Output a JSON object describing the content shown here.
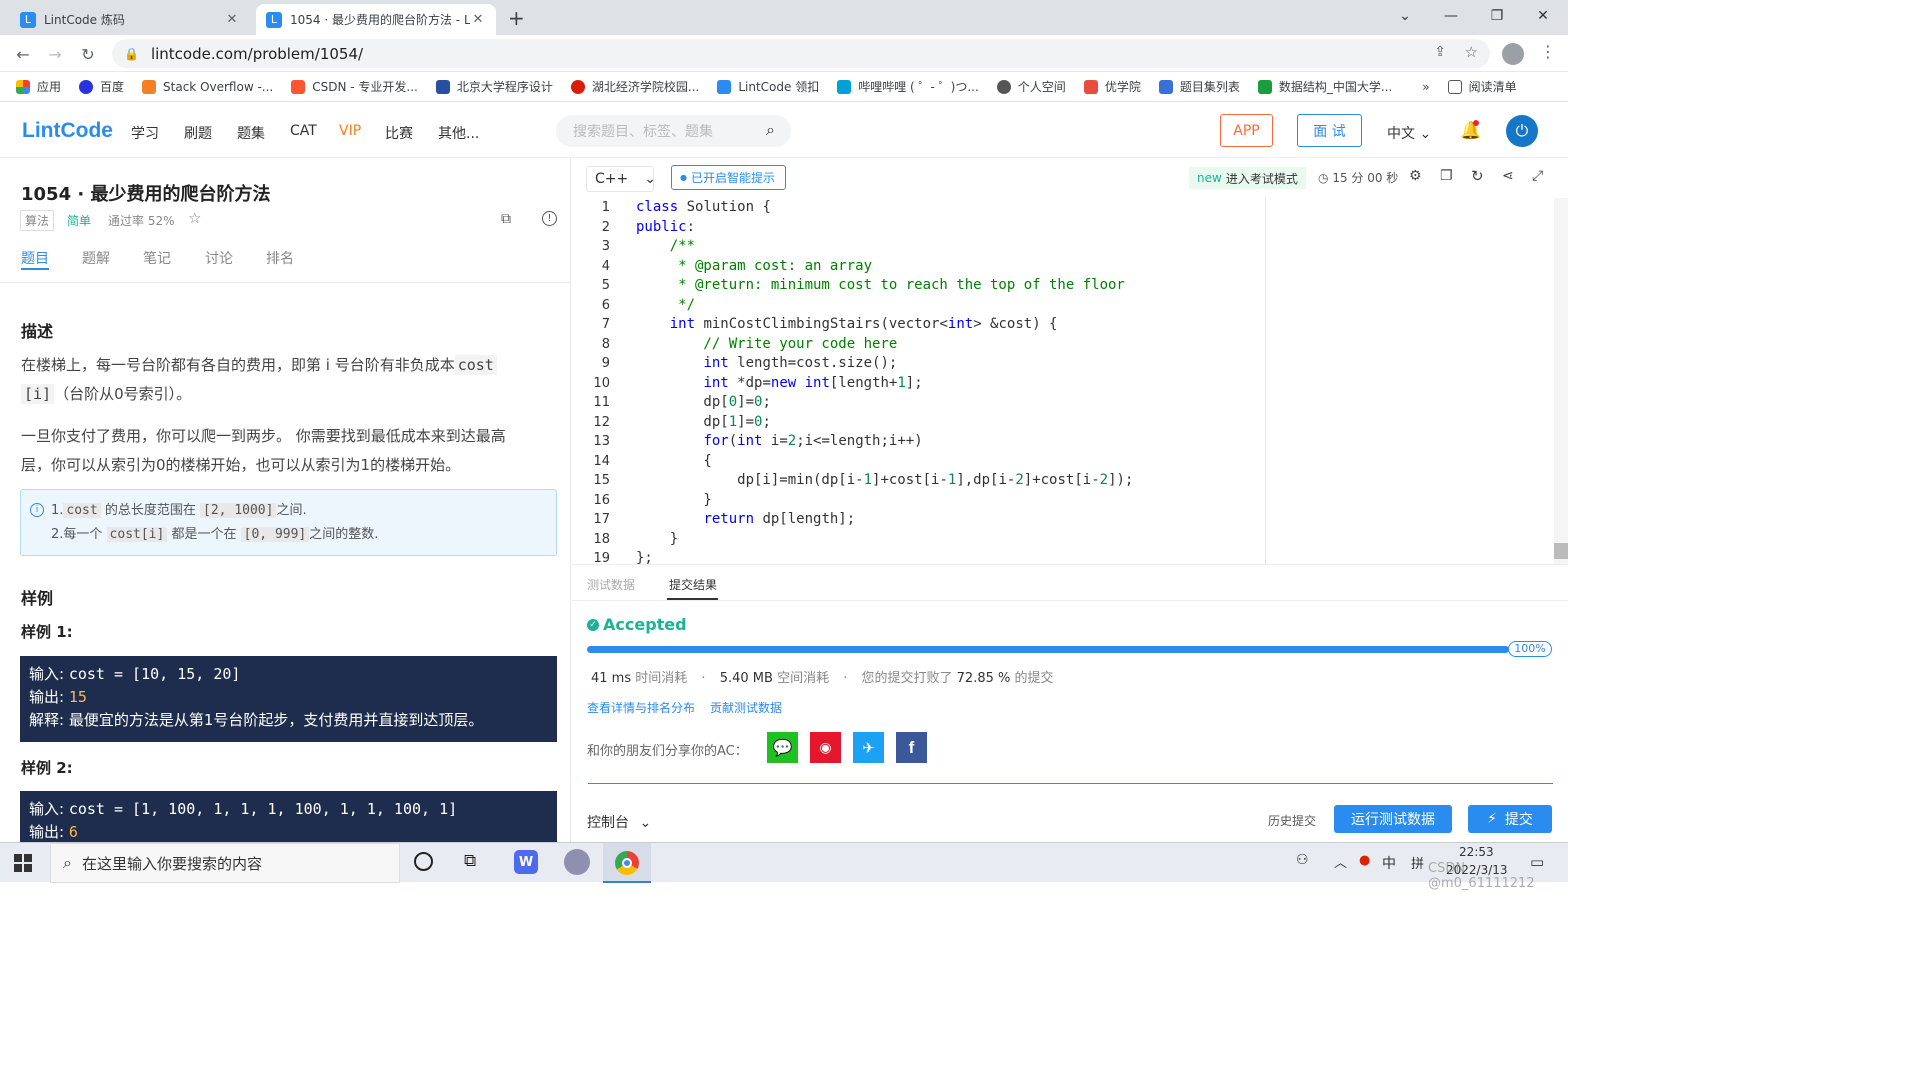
{
  "browser": {
    "tabs": [
      {
        "title": "LintCode 炼码",
        "close": "✕"
      },
      {
        "title": "1054 · 最少费用的爬台阶方法 - L",
        "close": "✕"
      }
    ],
    "new_tab": "+",
    "url": "lintcode.com/problem/1054/",
    "bookmarks": [
      "应用",
      "百度",
      "Stack Overflow -...",
      "CSDN - 专业开发...",
      "北京大学程序设计",
      "湖北经济学院校园...",
      "LintCode 领扣",
      "哔哩哔哩 ( ゜- ゜)つ...",
      "个人空间",
      "优学院",
      "题目集列表",
      "数据结构_中国大学..."
    ],
    "bookmark_more": "»",
    "reading_list": "阅读清单"
  },
  "site": {
    "logo": "LintCode",
    "nav": [
      "学习",
      "刷题",
      "题集",
      "CAT",
      "VIP",
      "比赛",
      "其他..."
    ],
    "search_placeholder": "搜索题目、标签、题集",
    "app_button": "APP",
    "interview_button": "面 试",
    "language": "中文"
  },
  "problem": {
    "title": "1054 · 最少费用的爬台阶方法",
    "tag": "算法",
    "difficulty": "简单",
    "pass_rate": "通过率 52%",
    "tabs": [
      "题目",
      "题解",
      "笔记",
      "讨论",
      "排名"
    ],
    "desc_heading": "描述",
    "desc_p1a": "在楼梯上，每一号台阶都有各自的费用，即第 i 号台阶有非负成本",
    "desc_code1": "cost",
    "desc_code2": "[i]",
    "desc_p1b": "（台阶从0号索引）。",
    "desc_p2a": "一旦你支付了费用，你可以爬一到两步。 你需要找到最低成本来到达最高",
    "desc_p2b": "层，你可以从索引为0的楼梯开始，也可以从索引为1的楼梯开始。",
    "note1_pre": "1.",
    "note1_code": "cost",
    "note1_mid": "的总长度范围在",
    "note1_range": "[2, 1000]",
    "note1_post": "之间.",
    "note2_pre": "2.每一个",
    "note2_code": "cost[i]",
    "note2_mid": "都是一个在",
    "note2_range": "[0, 999]",
    "note2_post": "之间的整数.",
    "examples_heading": "样例",
    "ex1_heading": "样例 1:",
    "ex1_input_label": "输入: ",
    "ex1_input": "cost = [10, 15, 20]",
    "ex1_output_label": "输出: ",
    "ex1_output": "15",
    "ex1_explain_label": "解释: ",
    "ex1_explain": "最便宜的方法是从第1号台阶起步，支付费用并直接到达顶层。",
    "ex2_heading": "样例 2:",
    "ex2_input_label": "输入: ",
    "ex2_input": "cost = [1, 100, 1, 1, 1, 100, 1, 1, 100, 1]",
    "ex2_output_label": "输出: ",
    "ex2_output": "6"
  },
  "editor": {
    "language": "C++",
    "smart_hint": "已开启智能提示",
    "exam_badge": "new",
    "exam_label": "进入考试模式",
    "timer": "15 分 00 秒",
    "line_numbers": [
      "1",
      "2",
      "3",
      "4",
      "5",
      "6",
      "7",
      "8",
      "9",
      "10",
      "11",
      "12",
      "13",
      "14",
      "15",
      "16",
      "17",
      "18",
      "19"
    ]
  },
  "result": {
    "tabs": [
      "测试数据",
      "提交结果"
    ],
    "status": "Accepted",
    "progress_label": "100%",
    "progress_value": 1.0,
    "time_value": "41 ms",
    "time_label": "时间消耗",
    "mem_value": "5.40 MB",
    "mem_label": "空间消耗",
    "beat_pre": "您的提交打败了",
    "beat_value": "72.85 %",
    "beat_post": "的提交",
    "link_details": "查看详情与排名分布",
    "link_contribute": "贡献测试数据",
    "share_label": "和你的朋友们分享你的AC："
  },
  "bottom": {
    "console": "控制台",
    "history": "历史提交",
    "run": "运行测试数据",
    "submit": "提交"
  },
  "taskbar": {
    "search_placeholder": "在这里输入你要搜索的内容",
    "ime1": "中",
    "ime2": "拼",
    "time": "22:53",
    "date": "2022/3/13",
    "watermark": "CSDN @m0_61111212"
  },
  "colors": {
    "brand": "#2b8cf0",
    "accepted": "#1ab394",
    "vip": "#ff7d1a",
    "app_border": "#ff6a3d",
    "example_bg": "#1e2d4d"
  }
}
